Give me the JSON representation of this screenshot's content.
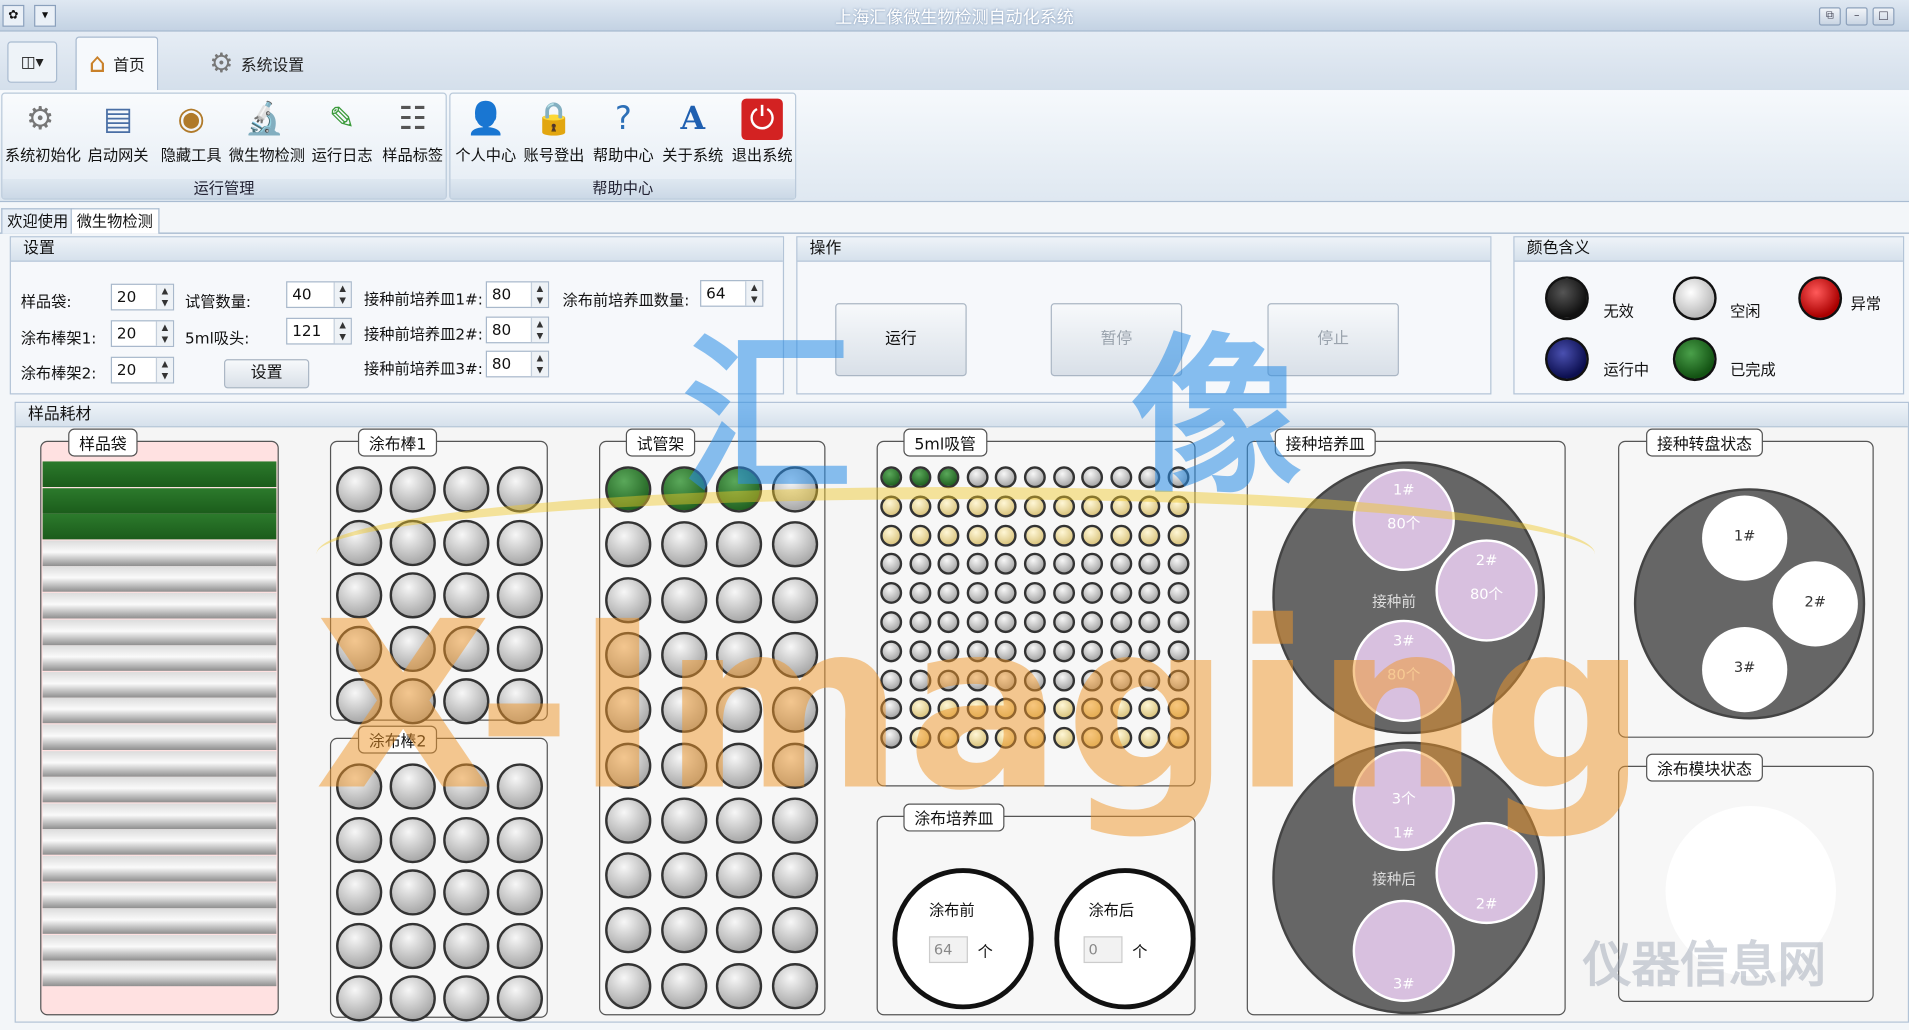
{
  "window": {
    "title": "上海汇像微生物检测自动化系统"
  },
  "ribbon": {
    "tabs": [
      {
        "label": "首页"
      },
      {
        "label": "系统设置"
      }
    ],
    "groups": {
      "run": "运行管理",
      "help": "帮助中心"
    },
    "buttons": [
      "系统初始化",
      "启动网关",
      "隐藏工具",
      "微生物检测",
      "运行日志",
      "样品标签",
      "个人中心",
      "账号登出",
      "帮助中心",
      "关于系统",
      "退出系统"
    ]
  },
  "doc_tabs": [
    "欢迎使用",
    "微生物检测"
  ],
  "settings": {
    "title": "设置",
    "sample_bag_label": "样品袋:",
    "sample_bag": "20",
    "rack1_label": "涂布棒架1:",
    "rack1": "20",
    "rack2_label": "涂布棒架2:",
    "rack2": "20",
    "tube_count_label": "试管数量:",
    "tube_count": "40",
    "tip_label": "5ml吸头:",
    "tip": "121",
    "set_button": "设置",
    "dish1_label": "接种前培养皿1#:",
    "dish1": "80",
    "dish2_label": "接种前培养皿2#:",
    "dish2": "80",
    "dish3_label": "接种前培养皿3#:",
    "dish3": "80",
    "spread_count_label": "涂布前培养皿数量:",
    "spread_count": "64"
  },
  "operation": {
    "title": "操作",
    "run": "运行",
    "pause": "暂停",
    "stop": "停止"
  },
  "legend": {
    "title": "颜色含义",
    "items": [
      {
        "label": "无效",
        "color": "#111111"
      },
      {
        "label": "空闲",
        "color": "#d8d8d8"
      },
      {
        "label": "异常",
        "color": "#c01010"
      },
      {
        "label": "运行中",
        "color": "#1a1e6e"
      },
      {
        "label": "已完成",
        "color": "#1f6b1f"
      }
    ]
  },
  "consumables": {
    "title": "样品耗材",
    "sample_bag": {
      "title": "样品袋",
      "total": 20,
      "completed": 3
    },
    "rod1": {
      "title": "涂布棒1"
    },
    "rod2": {
      "title": "涂布棒2"
    },
    "tube_rack": {
      "title": "试管架",
      "completed": 3
    },
    "tips": {
      "title": "5ml吸管",
      "completed": 3
    },
    "spread_dish": {
      "title": "涂布培养皿",
      "before_label": "涂布前",
      "before_value": "64",
      "after_label": "涂布后",
      "after_value": "0",
      "unit": "个"
    },
    "inoc_dish": {
      "title": "接种培养皿",
      "before_center": "接种前",
      "after_center": "接种后",
      "d1": "1#",
      "d1_count": "80个",
      "d2": "2#",
      "d2_count": "80个",
      "d3": "3#",
      "d3_count": "80个",
      "a3": "3个",
      "a1": "1#",
      "a2": "2#",
      "a3b": "3#"
    },
    "turntable": {
      "title": "接种转盘状态",
      "s1": "1#",
      "s2": "2#",
      "s3": "3#"
    },
    "spread_module": {
      "title": "涂布模块状态"
    }
  },
  "watermark": {
    "cn": "汇 像",
    "en": "X-Imaging",
    "site": "仪器信息网"
  },
  "colors": {
    "completed": "#1f6b1f",
    "dish": "#d8c0df",
    "plate": "#666666"
  }
}
